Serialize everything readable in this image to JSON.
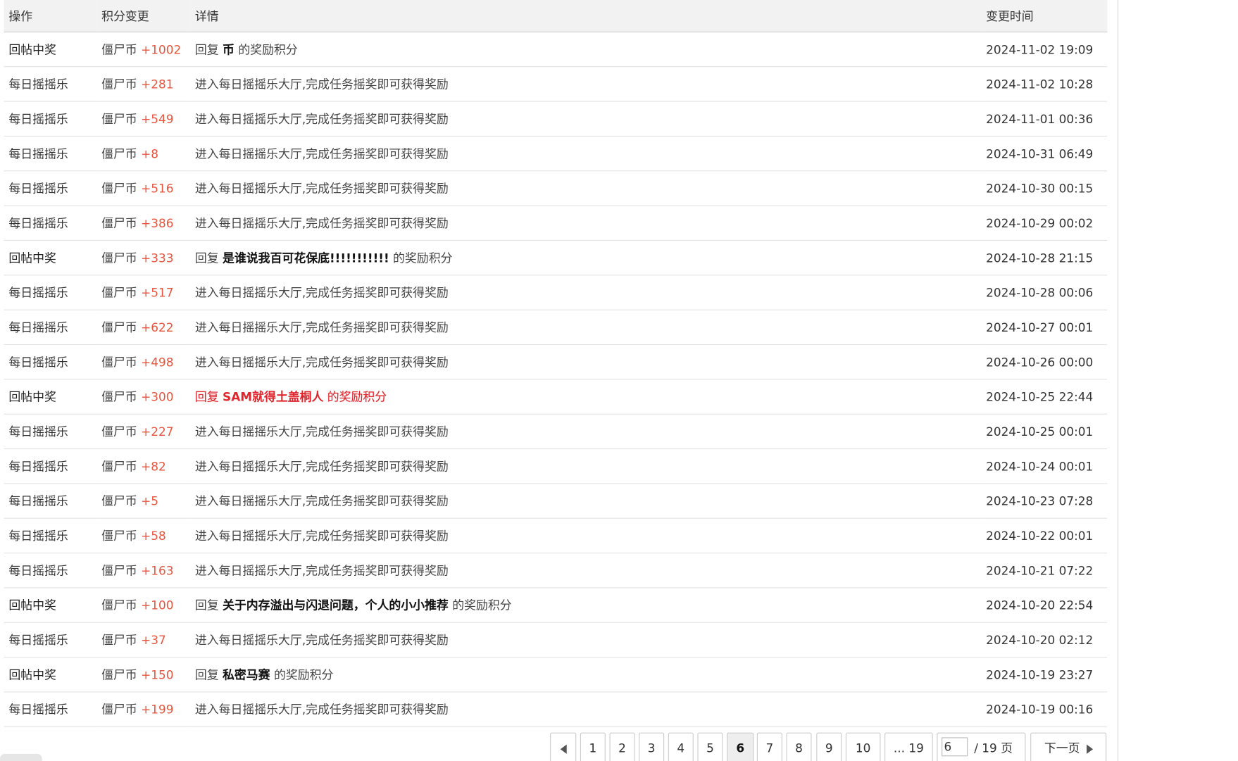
{
  "table": {
    "headers": {
      "operation": "操作",
      "change": "积分变更",
      "detail": "详情",
      "time": "变更时间"
    },
    "rows": [
      {
        "op": "回帖中奖",
        "coin": "僵尸币",
        "amount": "+1002",
        "pre": "回复",
        "title": "币",
        "post": "的奖励积分",
        "time": "2024-11-02 19:09",
        "strong": true,
        "highlight": false
      },
      {
        "op": "每日摇摇乐",
        "coin": "僵尸币",
        "amount": "+281",
        "pre": "进入每日摇摇乐大厅,完成任务摇奖即可获得奖励",
        "title": "",
        "post": "",
        "time": "2024-11-02 10:28",
        "strong": false,
        "highlight": false
      },
      {
        "op": "每日摇摇乐",
        "coin": "僵尸币",
        "amount": "+549",
        "pre": "进入每日摇摇乐大厅,完成任务摇奖即可获得奖励",
        "title": "",
        "post": "",
        "time": "2024-11-01 00:36",
        "strong": false,
        "highlight": false
      },
      {
        "op": "每日摇摇乐",
        "coin": "僵尸币",
        "amount": "+8",
        "pre": "进入每日摇摇乐大厅,完成任务摇奖即可获得奖励",
        "title": "",
        "post": "",
        "time": "2024-10-31 06:49",
        "strong": false,
        "highlight": false
      },
      {
        "op": "每日摇摇乐",
        "coin": "僵尸币",
        "amount": "+516",
        "pre": "进入每日摇摇乐大厅,完成任务摇奖即可获得奖励",
        "title": "",
        "post": "",
        "time": "2024-10-30 00:15",
        "strong": false,
        "highlight": false
      },
      {
        "op": "每日摇摇乐",
        "coin": "僵尸币",
        "amount": "+386",
        "pre": "进入每日摇摇乐大厅,完成任务摇奖即可获得奖励",
        "title": "",
        "post": "",
        "time": "2024-10-29 00:02",
        "strong": false,
        "highlight": false
      },
      {
        "op": "回帖中奖",
        "coin": "僵尸币",
        "amount": "+333",
        "pre": "回复",
        "title": "是谁说我百可花保底!!!!!!!!!!!",
        "post": "的奖励积分",
        "time": "2024-10-28 21:15",
        "strong": true,
        "highlight": false
      },
      {
        "op": "每日摇摇乐",
        "coin": "僵尸币",
        "amount": "+517",
        "pre": "进入每日摇摇乐大厅,完成任务摇奖即可获得奖励",
        "title": "",
        "post": "",
        "time": "2024-10-28 00:06",
        "strong": false,
        "highlight": false
      },
      {
        "op": "每日摇摇乐",
        "coin": "僵尸币",
        "amount": "+622",
        "pre": "进入每日摇摇乐大厅,完成任务摇奖即可获得奖励",
        "title": "",
        "post": "",
        "time": "2024-10-27 00:01",
        "strong": false,
        "highlight": false
      },
      {
        "op": "每日摇摇乐",
        "coin": "僵尸币",
        "amount": "+498",
        "pre": "进入每日摇摇乐大厅,完成任务摇奖即可获得奖励",
        "title": "",
        "post": "",
        "time": "2024-10-26 00:00",
        "strong": false,
        "highlight": false
      },
      {
        "op": "回帖中奖",
        "coin": "僵尸币",
        "amount": "+300",
        "pre": "回复",
        "title": "SAM就得土盖桐人",
        "post": "的奖励积分",
        "time": "2024-10-25 22:44",
        "strong": true,
        "highlight": true
      },
      {
        "op": "每日摇摇乐",
        "coin": "僵尸币",
        "amount": "+227",
        "pre": "进入每日摇摇乐大厅,完成任务摇奖即可获得奖励",
        "title": "",
        "post": "",
        "time": "2024-10-25 00:01",
        "strong": false,
        "highlight": false
      },
      {
        "op": "每日摇摇乐",
        "coin": "僵尸币",
        "amount": "+82",
        "pre": "进入每日摇摇乐大厅,完成任务摇奖即可获得奖励",
        "title": "",
        "post": "",
        "time": "2024-10-24 00:01",
        "strong": false,
        "highlight": false
      },
      {
        "op": "每日摇摇乐",
        "coin": "僵尸币",
        "amount": "+5",
        "pre": "进入每日摇摇乐大厅,完成任务摇奖即可获得奖励",
        "title": "",
        "post": "",
        "time": "2024-10-23 07:28",
        "strong": false,
        "highlight": false
      },
      {
        "op": "每日摇摇乐",
        "coin": "僵尸币",
        "amount": "+58",
        "pre": "进入每日摇摇乐大厅,完成任务摇奖即可获得奖励",
        "title": "",
        "post": "",
        "time": "2024-10-22 00:01",
        "strong": false,
        "highlight": false
      },
      {
        "op": "每日摇摇乐",
        "coin": "僵尸币",
        "amount": "+163",
        "pre": "进入每日摇摇乐大厅,完成任务摇奖即可获得奖励",
        "title": "",
        "post": "",
        "time": "2024-10-21 07:22",
        "strong": false,
        "highlight": false
      },
      {
        "op": "回帖中奖",
        "coin": "僵尸币",
        "amount": "+100",
        "pre": "回复",
        "title": "关于内存溢出与闪退问题，个人的小小推荐",
        "post": "的奖励积分",
        "time": "2024-10-20 22:54",
        "strong": true,
        "highlight": false
      },
      {
        "op": "每日摇摇乐",
        "coin": "僵尸币",
        "amount": "+37",
        "pre": "进入每日摇摇乐大厅,完成任务摇奖即可获得奖励",
        "title": "",
        "post": "",
        "time": "2024-10-20 02:12",
        "strong": false,
        "highlight": false
      },
      {
        "op": "回帖中奖",
        "coin": "僵尸币",
        "amount": "+150",
        "pre": "回复",
        "title": "私密马赛",
        "post": "的奖励积分",
        "time": "2024-10-19 23:27",
        "strong": true,
        "highlight": false
      },
      {
        "op": "每日摇摇乐",
        "coin": "僵尸币",
        "amount": "+199",
        "pre": "进入每日摇摇乐大厅,完成任务摇奖即可获得奖励",
        "title": "",
        "post": "",
        "time": "2024-10-19 00:16",
        "strong": false,
        "highlight": false
      }
    ]
  },
  "pagination": {
    "pages": [
      "1",
      "2",
      "3",
      "4",
      "5",
      "6",
      "7",
      "8",
      "9",
      "10"
    ],
    "current": "6",
    "last_label": "... 19",
    "jump_value": "6",
    "total_label": "/ 19 页",
    "next_label": "下一页",
    "prev_icon": "triangle-left-icon",
    "next_icon": "triangle-right-icon"
  },
  "colors": {
    "amount": "#e8553e",
    "highlight": "#e0262d",
    "header_bg": "#f2f2f2"
  }
}
